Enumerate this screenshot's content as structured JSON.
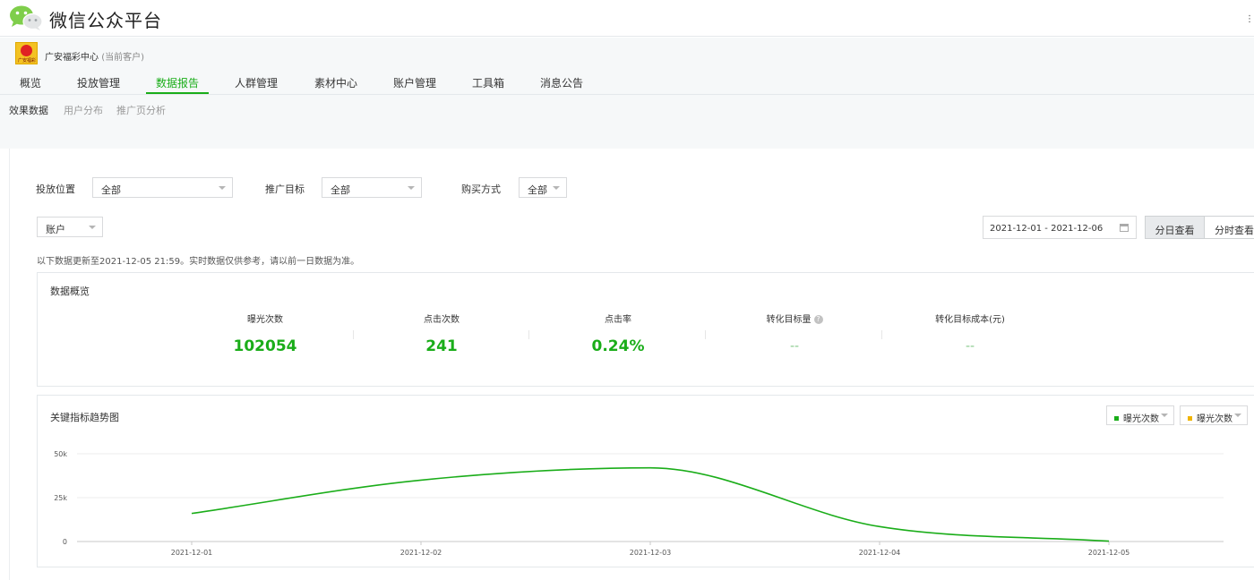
{
  "header": {
    "title": "微信公众平台"
  },
  "account": {
    "logo_text": "广安福彩",
    "name": "广安福彩中心",
    "status": "(当前客户)"
  },
  "nav": {
    "items": [
      "概览",
      "投放管理",
      "数据报告",
      "人群管理",
      "素材中心",
      "账户管理",
      "工具箱",
      "消息公告"
    ],
    "active_index": 2
  },
  "subnav": {
    "items": [
      "效果数据",
      "用户分布",
      "推广页分析"
    ],
    "active_index": 0
  },
  "filters": {
    "placement_label": "投放位置",
    "placement_value": "全部",
    "target_label": "推广目标",
    "target_value": "全部",
    "buy_label": "购买方式",
    "buy_value": "全部",
    "level_value": "账户"
  },
  "date": {
    "range": "2021-12-01 - 2021-12-06",
    "by_day": "分日查看",
    "by_hour": "分时查看"
  },
  "notice": "以下数据更新至2021-12-05 21:59。实时数据仅供参考，请以前一日数据为准。",
  "overview": {
    "title": "数据概览",
    "metrics": [
      {
        "label": "曝光次数",
        "value": "102054"
      },
      {
        "label": "点击次数",
        "value": "241"
      },
      {
        "label": "点击率",
        "value": "0.24%"
      },
      {
        "label": "转化目标量",
        "value": "--"
      },
      {
        "label": "转化目标成本(元)",
        "value": "--"
      }
    ]
  },
  "trend": {
    "title": "关键指标趋势图",
    "legend": [
      {
        "label": "曝光次数",
        "color": "#1aad19"
      },
      {
        "label": "曝光次数",
        "color": "#f0b400"
      }
    ]
  },
  "chart_data": {
    "type": "line",
    "x": [
      "2021-12-01",
      "2021-12-02",
      "2021-12-03",
      "2021-12-04",
      "2021-12-05"
    ],
    "series": [
      {
        "name": "曝光次数",
        "values": [
          16000,
          35000,
          42000,
          8500,
          200
        ],
        "color": "#1aad19"
      }
    ],
    "yticks": [
      "0",
      "25k",
      "50k"
    ],
    "ylim": [
      0,
      50000
    ],
    "grid": true
  }
}
